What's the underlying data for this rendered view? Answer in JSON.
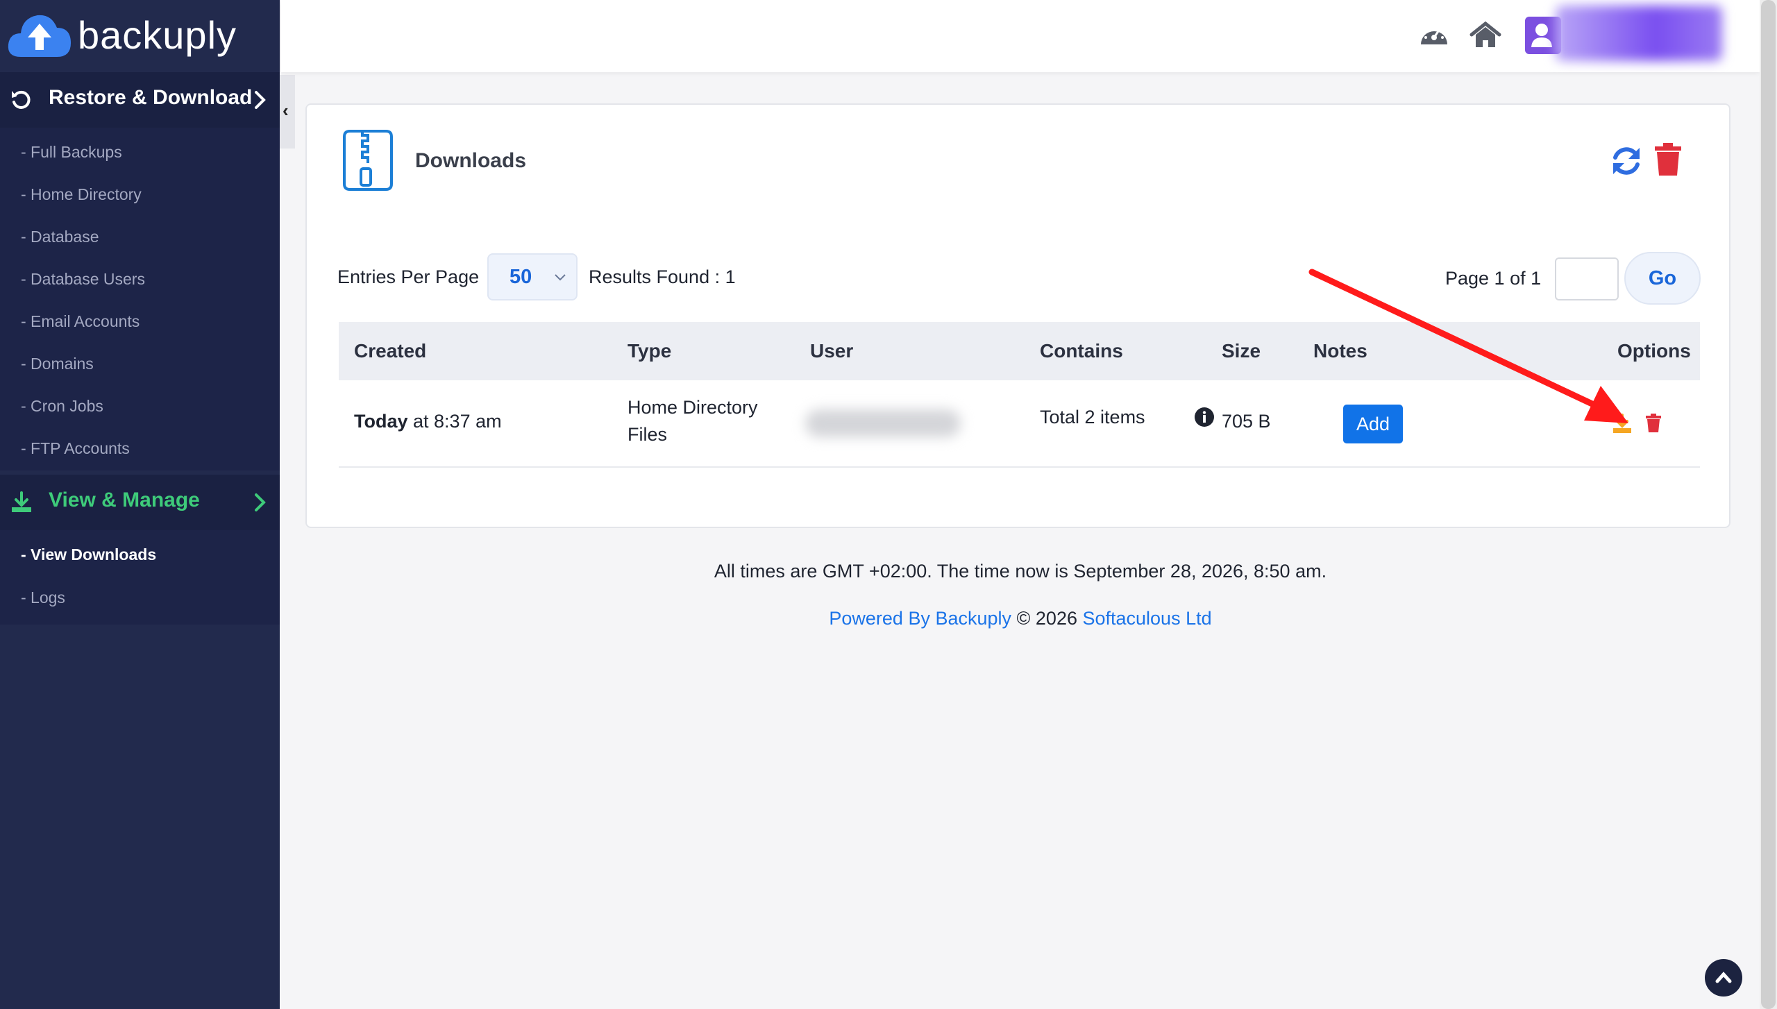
{
  "brand": {
    "name": "backuply"
  },
  "sidebar": {
    "restore_section": {
      "label": "Restore & Download"
    },
    "restore_items": [
      {
        "label": "- Full Backups"
      },
      {
        "label": "- Home Directory"
      },
      {
        "label": "- Database"
      },
      {
        "label": "- Database Users"
      },
      {
        "label": "- Email Accounts"
      },
      {
        "label": "- Domains"
      },
      {
        "label": "- Cron Jobs"
      },
      {
        "label": "- FTP Accounts"
      }
    ],
    "manage_section": {
      "label": "View & Manage"
    },
    "manage_items": [
      {
        "label": "- View Downloads",
        "active": true
      },
      {
        "label": "- Logs"
      }
    ],
    "collapse_glyph": "‹"
  },
  "header": {
    "icons": [
      "dashboard-icon",
      "home-icon",
      "user-icon"
    ]
  },
  "card": {
    "title": "Downloads",
    "entries_label": "Entries Per Page",
    "entries_value": "50",
    "results_label": "Results Found : 1",
    "page_label": "Page 1 of 1",
    "page_input_value": "",
    "go_label": "Go"
  },
  "table": {
    "headers": [
      "Created",
      "Type",
      "User",
      "Contains",
      "Size",
      "Notes",
      "Options"
    ],
    "rows": [
      {
        "created_bold": "Today",
        "created_rest": " at 8:37 am",
        "type_line1": "Home Directory",
        "type_line2": "Files",
        "contains": "Total 2 items",
        "size": "705 B",
        "notes_button": "Add"
      }
    ]
  },
  "footer": {
    "time_text": "All times are GMT +02:00. The time now is September 28, 2026, 8:50 am.",
    "powered": "Powered By Backuply",
    "copyright": " © 2026 ",
    "company": "Softaculous Ltd"
  },
  "colors": {
    "sidebar_bg": "#222a4d",
    "accent_blue": "#1a73e8",
    "green": "#3ecb7a",
    "danger": "#e0303c",
    "download_orange": "#f5a623",
    "annotation_red": "#ff1b1b"
  }
}
